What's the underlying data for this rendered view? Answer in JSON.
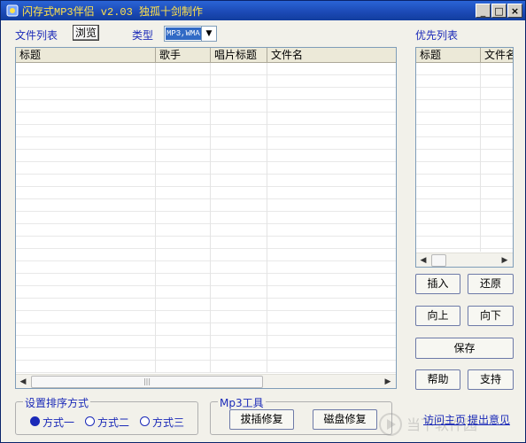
{
  "window": {
    "title": "闪存式MP3伴侣 v2.03 独孤十剑制作",
    "controls": {
      "minimize": "_",
      "maximize": "□",
      "close": "×"
    }
  },
  "toolbar": {
    "file_list_label": "文件列表",
    "browse_button": "浏览",
    "type_label": "类型",
    "type_value": "MP3,WMA",
    "priority_list_label": "优先列表"
  },
  "file_table": {
    "columns": [
      "标题",
      "歌手",
      "唱片标题",
      "文件名"
    ],
    "rows": []
  },
  "priority_table": {
    "columns": [
      "标题",
      "文件名"
    ],
    "rows": []
  },
  "right_buttons": {
    "insert": "插入",
    "restore": "还原",
    "move_up": "向上",
    "move_down": "向下",
    "save": "保存",
    "help": "帮助",
    "support": "支持"
  },
  "sort_group": {
    "title": "设置排序方式",
    "options": [
      "方式一",
      "方式二",
      "方式三"
    ],
    "selected_index": 0
  },
  "mp3_tools": {
    "title": "Mp3工具",
    "buttons": [
      "拔插修复",
      "磁盘修复"
    ]
  },
  "links": {
    "visit_home": "访问主页",
    "feedback": "提出意见"
  },
  "watermark_text": "当下软件园",
  "colors": {
    "titlebar": "#1b49b4",
    "title_text": "#ffe14a",
    "label_blue": "#1b2ab8",
    "selection": "#316ac5"
  }
}
